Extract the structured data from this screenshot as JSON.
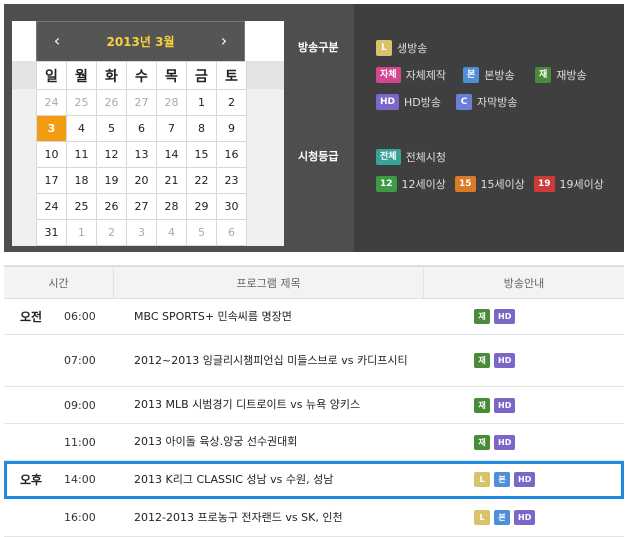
{
  "calendar": {
    "title": "2013년 3월",
    "prev": "‹",
    "next": "›",
    "weekdays": [
      "일",
      "월",
      "화",
      "수",
      "목",
      "금",
      "토"
    ],
    "weeks": [
      [
        "24",
        "25",
        "26",
        "27",
        "28",
        "1",
        "2"
      ],
      [
        "3",
        "4",
        "5",
        "6",
        "7",
        "8",
        "9"
      ],
      [
        "10",
        "11",
        "12",
        "13",
        "14",
        "15",
        "16"
      ],
      [
        "17",
        "18",
        "19",
        "20",
        "21",
        "22",
        "23"
      ],
      [
        "24",
        "25",
        "26",
        "27",
        "28",
        "29",
        "30"
      ],
      [
        "31",
        "1",
        "2",
        "3",
        "4",
        "5",
        "6"
      ]
    ],
    "selected": "3"
  },
  "legend": {
    "broadcast_type_title": "방송구분",
    "rating_title": "시청등급",
    "types": [
      {
        "badge": "L",
        "label": "생방송"
      },
      {
        "badge": "자체",
        "label": "자체제작"
      },
      {
        "badge": "본",
        "label": "본방송"
      },
      {
        "badge": "재",
        "label": "재방송"
      },
      {
        "badge": "HD",
        "label": "HD방송"
      },
      {
        "badge": "C",
        "label": "자막방송"
      }
    ],
    "ratings": [
      {
        "badge": "전체",
        "label": "전체시청"
      },
      {
        "badge": "12",
        "label": "12세이상"
      },
      {
        "badge": "15",
        "label": "15세이상"
      },
      {
        "badge": "19",
        "label": "19세이상"
      }
    ]
  },
  "schedule": {
    "headers": {
      "time": "시간",
      "program": "프로그램 제목",
      "info": "방송안내"
    },
    "rows": [
      {
        "ampm": "오전",
        "time": "06:00",
        "title": "MBC SPORTS+ 민속씨름 명장면",
        "badges": [
          "재",
          "HD"
        ]
      },
      {
        "ampm": "",
        "time": "07:00",
        "title": "2012~2013 잉글리시챔피언십 미들스브로 vs 카디프시티",
        "badges": [
          "재",
          "HD"
        ]
      },
      {
        "ampm": "",
        "time": "09:00",
        "title": "2013 MLB 시범경기 디트로이트 vs 뉴욕 양키스",
        "badges": [
          "재",
          "HD"
        ]
      },
      {
        "ampm": "",
        "time": "11:00",
        "title": "2013 아이돌 육상.양궁 선수권대회",
        "badges": [
          "재",
          "HD"
        ]
      },
      {
        "ampm": "오후",
        "time": "14:00",
        "title": "2013 K리그 CLASSIC 성남 vs 수원, 성남",
        "badges": [
          "L",
          "본",
          "HD"
        ]
      },
      {
        "ampm": "",
        "time": "16:00",
        "title": "2012-2013 프로농구 전자랜드 vs SK, 인천",
        "badges": [
          "L",
          "본",
          "HD"
        ]
      }
    ]
  }
}
